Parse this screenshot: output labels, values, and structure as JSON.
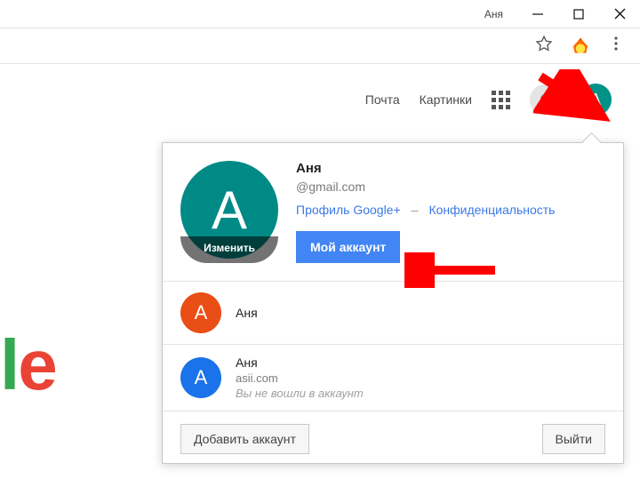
{
  "window": {
    "title": "Аня"
  },
  "header": {
    "mail": "Почта",
    "images": "Картинки",
    "avatar_initial": "A"
  },
  "logo_fragment": {
    "l": "l",
    "e": "e"
  },
  "popover": {
    "name": "Аня",
    "email": "@gmail.com",
    "avatar_initial": "A",
    "edit_label": "Изменить",
    "profile_link": "Профиль Google+",
    "privacy_link": "Конфиденциальность",
    "my_account": "Мой аккаунт",
    "accounts": [
      {
        "initial": "A",
        "color": "A-orange",
        "name": "Аня",
        "sub": "",
        "note": ""
      },
      {
        "initial": "A",
        "color": "A-blue",
        "name": "Аня",
        "sub": "asii.com",
        "note": "Вы не вошли в аккаунт"
      }
    ],
    "add_account": "Добавить аккаунт",
    "sign_out": "Выйти"
  }
}
